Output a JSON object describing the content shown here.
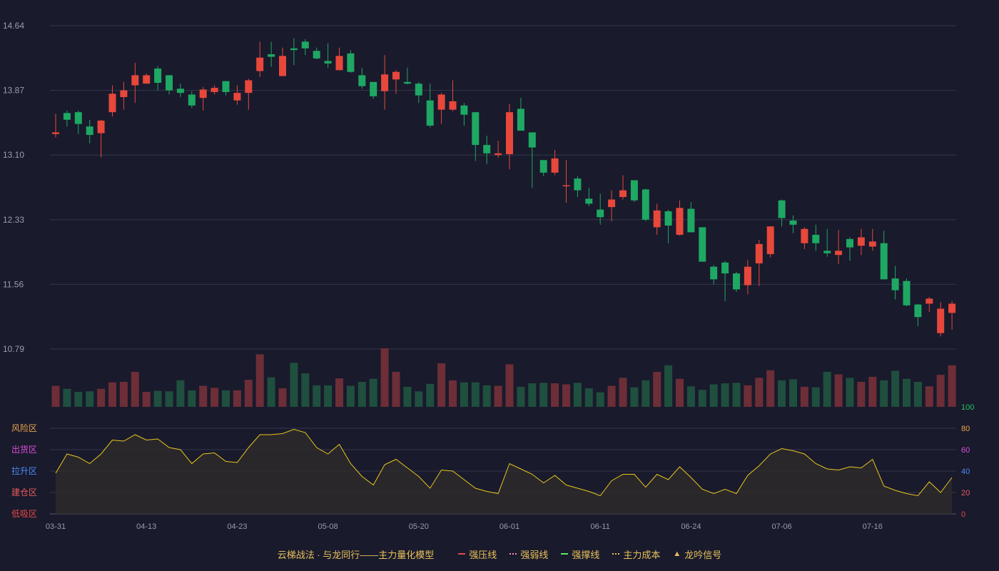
{
  "colors": {
    "up": "#e7483b",
    "down": "#1ea863",
    "vol_up": "#6d2e37",
    "vol_down": "#1f4f3e",
    "grid": "#34364d",
    "axis_text": "#9a9cad",
    "osc_line": "#e8c61f",
    "osc_fill": "#2e2a2a",
    "zone_risk": "#e8a44a",
    "zone_distribute": "#d94fd8",
    "zone_rise": "#4b8bf5",
    "zone_build": "#e85a5a",
    "zone_absorb": "#e84848",
    "tick_100": "#22c55e",
    "tick_80": "#e8a44a",
    "tick_60": "#d94fd8",
    "tick_40": "#4b8bf5",
    "tick_20": "#e85a5a",
    "tick_0": "#e84848"
  },
  "chart_data": {
    "type": "candlestick",
    "price_axis": {
      "ticks": [
        "14.64",
        "13.87",
        "13.10",
        "12.33",
        "11.56",
        "10.79"
      ],
      "ylim": [
        10.79,
        14.64
      ]
    },
    "x_ticks": [
      {
        "label": "03-31",
        "index": 0
      },
      {
        "label": "04-13",
        "index": 8
      },
      {
        "label": "04-23",
        "index": 16
      },
      {
        "label": "05-08",
        "index": 24
      },
      {
        "label": "05-20",
        "index": 32
      },
      {
        "label": "06-01",
        "index": 40
      },
      {
        "label": "06-11",
        "index": 48
      },
      {
        "label": "06-24",
        "index": 56
      },
      {
        "label": "07-06",
        "index": 64
      },
      {
        "label": "07-16",
        "index": 72
      }
    ],
    "candles": [
      [
        13.35,
        13.37,
        13.59,
        13.31
      ],
      [
        13.6,
        13.52,
        13.63,
        13.44
      ],
      [
        13.61,
        13.47,
        13.63,
        13.35
      ],
      [
        13.44,
        13.34,
        13.52,
        13.24
      ],
      [
        13.36,
        13.51,
        13.52,
        13.07
      ],
      [
        13.61,
        13.83,
        13.93,
        13.56
      ],
      [
        13.79,
        13.87,
        13.97,
        13.64
      ],
      [
        13.93,
        14.05,
        14.2,
        13.72
      ],
      [
        13.95,
        14.05,
        14.07,
        13.95
      ],
      [
        14.13,
        13.96,
        14.16,
        13.87
      ],
      [
        14.05,
        13.87,
        14.05,
        13.82
      ],
      [
        13.89,
        13.84,
        13.95,
        13.79
      ],
      [
        13.82,
        13.69,
        13.86,
        13.66
      ],
      [
        13.78,
        13.88,
        13.91,
        13.63
      ],
      [
        13.85,
        13.9,
        13.93,
        13.82
      ],
      [
        13.98,
        13.85,
        13.98,
        13.81
      ],
      [
        13.75,
        13.84,
        13.93,
        13.7
      ],
      [
        13.84,
        13.99,
        14.01,
        13.64
      ],
      [
        14.1,
        14.26,
        14.45,
        14.03
      ],
      [
        14.3,
        14.27,
        14.45,
        14.15
      ],
      [
        14.04,
        14.28,
        14.38,
        14.04
      ],
      [
        14.37,
        14.35,
        14.49,
        14.17
      ],
      [
        14.45,
        14.37,
        14.48,
        14.29
      ],
      [
        14.34,
        14.25,
        14.38,
        14.24
      ],
      [
        14.22,
        14.19,
        14.43,
        14.14
      ],
      [
        14.11,
        14.28,
        14.38,
        14.12
      ],
      [
        14.31,
        14.09,
        14.35,
        14.08
      ],
      [
        14.05,
        13.92,
        14.14,
        13.89
      ],
      [
        13.97,
        13.8,
        13.97,
        13.77
      ],
      [
        13.86,
        14.06,
        14.29,
        13.64
      ],
      [
        14.0,
        14.09,
        14.11,
        13.83
      ],
      [
        13.97,
        13.95,
        14.14,
        13.94
      ],
      [
        13.95,
        13.81,
        13.97,
        13.72
      ],
      [
        13.75,
        13.45,
        13.95,
        13.43
      ],
      [
        13.64,
        13.82,
        13.84,
        13.47
      ],
      [
        13.64,
        13.74,
        13.99,
        13.62
      ],
      [
        13.69,
        13.58,
        13.72,
        13.45
      ],
      [
        13.61,
        13.22,
        13.61,
        13.03
      ],
      [
        13.22,
        13.12,
        13.33,
        12.99
      ],
      [
        13.1,
        13.12,
        13.27,
        13.07
      ],
      [
        13.11,
        13.61,
        13.71,
        12.93
      ],
      [
        13.65,
        13.39,
        13.78,
        13.39
      ],
      [
        13.37,
        13.19,
        13.37,
        12.71
      ],
      [
        13.04,
        12.89,
        13.04,
        12.85
      ],
      [
        12.89,
        13.06,
        13.16,
        12.86
      ],
      [
        12.73,
        12.74,
        13.04,
        12.53
      ],
      [
        12.82,
        12.68,
        12.85,
        12.6
      ],
      [
        12.58,
        12.52,
        12.71,
        12.49
      ],
      [
        12.45,
        12.36,
        12.64,
        12.27
      ],
      [
        12.48,
        12.57,
        12.68,
        12.31
      ],
      [
        12.6,
        12.68,
        12.86,
        12.57
      ],
      [
        12.8,
        12.56,
        12.8,
        12.54
      ],
      [
        12.69,
        12.33,
        12.7,
        12.31
      ],
      [
        12.24,
        12.44,
        12.52,
        12.15
      ],
      [
        12.43,
        12.26,
        12.45,
        12.05
      ],
      [
        12.15,
        12.47,
        12.56,
        12.14
      ],
      [
        12.46,
        12.18,
        12.54,
        12.18
      ],
      [
        12.24,
        11.83,
        12.24,
        11.83
      ],
      [
        11.77,
        11.62,
        11.79,
        11.56
      ],
      [
        11.82,
        11.69,
        11.84,
        11.36
      ],
      [
        11.69,
        11.5,
        11.71,
        11.47
      ],
      [
        11.55,
        11.77,
        11.85,
        11.44
      ],
      [
        11.81,
        12.04,
        12.09,
        11.54
      ],
      [
        11.92,
        12.25,
        12.25,
        11.88
      ],
      [
        12.56,
        12.35,
        12.57,
        12.25
      ],
      [
        12.32,
        12.27,
        12.38,
        12.17
      ],
      [
        12.05,
        12.22,
        12.24,
        11.98
      ],
      [
        12.15,
        12.05,
        12.27,
        11.96
      ],
      [
        11.96,
        11.93,
        12.22,
        11.89
      ],
      [
        11.91,
        11.96,
        12.21,
        11.8
      ],
      [
        12.1,
        12.0,
        12.12,
        11.84
      ],
      [
        12.02,
        12.12,
        12.22,
        11.91
      ],
      [
        12.01,
        12.07,
        12.22,
        11.96
      ],
      [
        12.05,
        11.62,
        12.2,
        11.62
      ],
      [
        11.63,
        11.49,
        11.78,
        11.38
      ],
      [
        11.6,
        11.31,
        11.63,
        11.3
      ],
      [
        11.32,
        11.17,
        11.33,
        11.06
      ],
      [
        11.33,
        11.39,
        11.41,
        11.23
      ],
      [
        10.98,
        11.27,
        11.35,
        10.94
      ],
      [
        11.22,
        11.33,
        11.36,
        11.02
      ]
    ],
    "volume": [
      42,
      36,
      30,
      31,
      36,
      49,
      50,
      70,
      30,
      32,
      31,
      53,
      33,
      42,
      38,
      33,
      33,
      54,
      105,
      59,
      37,
      88,
      67,
      43,
      43,
      57,
      42,
      50,
      56,
      117,
      70,
      40,
      31,
      46,
      87,
      53,
      49,
      49,
      43,
      42,
      85,
      40,
      47,
      48,
      47,
      45,
      48,
      37,
      29,
      42,
      58,
      39,
      53,
      70,
      83,
      56,
      41,
      34,
      45,
      47,
      48,
      43,
      58,
      73,
      53,
      55,
      40,
      39,
      70,
      65,
      58,
      50,
      60,
      53,
      72,
      56,
      50,
      41,
      64,
      83
    ],
    "oscillator": {
      "ylim": [
        0,
        100
      ],
      "ticks": [
        "100",
        "80",
        "60",
        "40",
        "20",
        "0"
      ],
      "zones": [
        "风险区",
        "出货区",
        "拉升区",
        "建仓区",
        "低吸区"
      ],
      "values": [
        38,
        56,
        53,
        47,
        56,
        69,
        68,
        74,
        69,
        70,
        62,
        60,
        47,
        56,
        57,
        49,
        48,
        62,
        74,
        74,
        75,
        79,
        76,
        62,
        56,
        65,
        47,
        35,
        27,
        46,
        51,
        43,
        35,
        24,
        41,
        40,
        32,
        24,
        21,
        19,
        47,
        42,
        37,
        29,
        36,
        27,
        24,
        21,
        17,
        31,
        37,
        37,
        25,
        37,
        32,
        44,
        34,
        23,
        19,
        23,
        19,
        36,
        45,
        56,
        61,
        59,
        56,
        47,
        42,
        41,
        44,
        43,
        51,
        26,
        22,
        19,
        17,
        30,
        20,
        34
      ]
    }
  },
  "legend": {
    "title": "云梯战法 · 与龙同行——主力量化模型",
    "items": [
      {
        "label": "强压线",
        "color": "#e84848",
        "style": "solid"
      },
      {
        "label": "强弱线",
        "color": "#ff8fb0",
        "style": "dotted"
      },
      {
        "label": "强撑线",
        "color": "#5be86a",
        "style": "solid"
      },
      {
        "label": "主力成本",
        "color": "#e8c15a",
        "style": "dotted"
      },
      {
        "label": "龙吟信号",
        "color": "#e8c15a",
        "style": "triangle"
      }
    ]
  }
}
